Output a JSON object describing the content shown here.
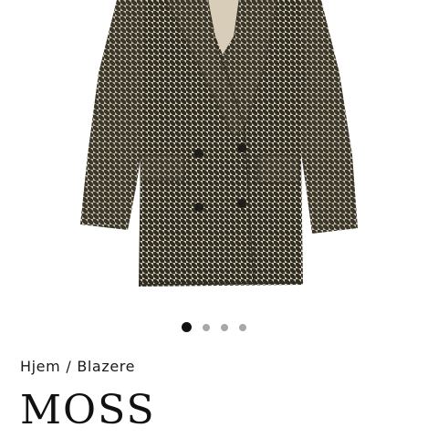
{
  "product": {
    "image_alt": "Houndstooth double-breasted blazer",
    "image_icon": "blazer-photo"
  },
  "carousel": {
    "slide_count": 4,
    "active_index": 0
  },
  "breadcrumb": {
    "home": "Hjem",
    "separator": "/",
    "category": "Blazere"
  },
  "brand": {
    "name": "MOSS"
  },
  "colors": {
    "dot_active": "#111111",
    "dot_inactive": "#a8a8a8",
    "text": "#1a1a1a"
  }
}
